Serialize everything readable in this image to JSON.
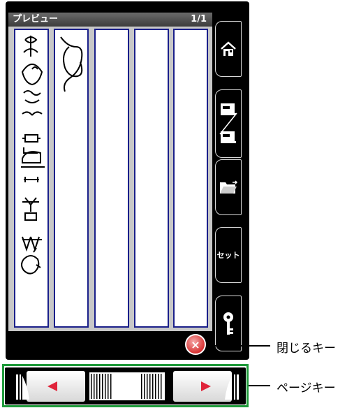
{
  "header": {
    "title": "プレビュー",
    "page_indicator": "1/1"
  },
  "preview": {
    "columns": 5
  },
  "side_buttons": [
    {
      "name": "home-button",
      "icon": "home-icon",
      "label": ""
    },
    {
      "name": "machine-toggle-button",
      "icon": "sewing-machine-icon",
      "label": ""
    },
    {
      "name": "open-folder-button",
      "icon": "folder-icon",
      "label": ""
    },
    {
      "name": "set-button",
      "icon": "",
      "label": "セット"
    },
    {
      "name": "lock-button",
      "icon": "key-icon",
      "label": ""
    }
  ],
  "close": {
    "icon": "close-icon",
    "symbol": "×",
    "callout": "閉じるキー"
  },
  "page_keys": {
    "callout": "ページキー"
  },
  "colors": {
    "column_border": "#1a1f8a",
    "highlight_frame": "#1e9a3a",
    "close_red": "#d83434"
  }
}
